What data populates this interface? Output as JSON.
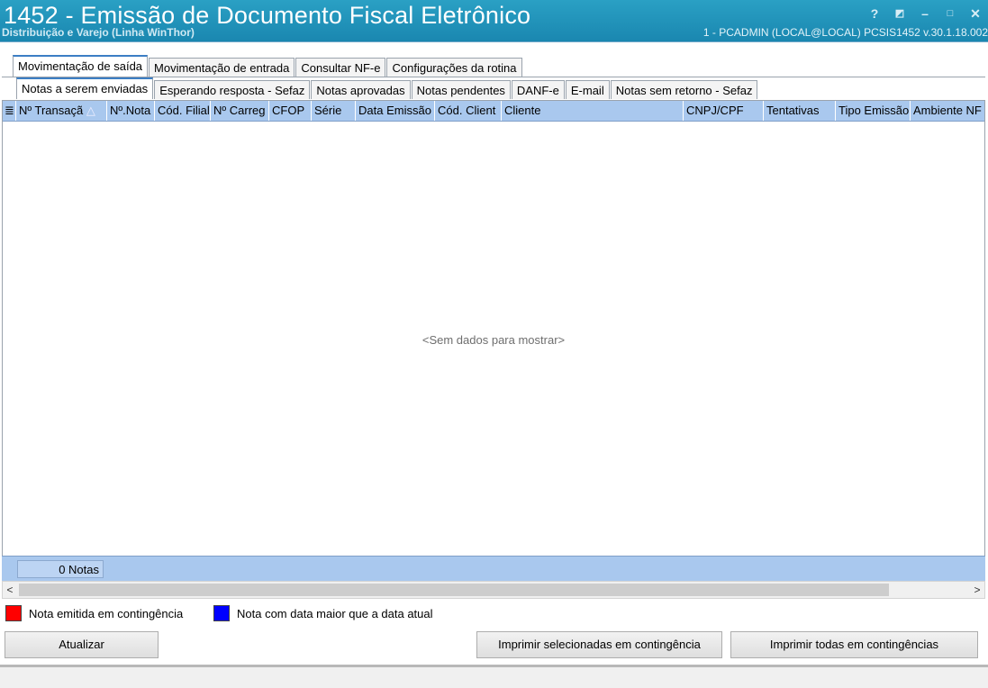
{
  "window": {
    "title": "1452 - Emissão de Documento Fiscal Eletrônico",
    "subtitle": "Distribuição e Varejo (Linha WinThor)",
    "userinfo": "1 - PCADMIN (LOCAL@LOCAL)   PCSIS1452  v.30.1.18.002",
    "buttons": {
      "help": "?",
      "restore": "◩",
      "minimize": "–",
      "maximize": "□",
      "close": "✕"
    }
  },
  "tabs_top": [
    {
      "label": "Movimentação de saída",
      "active": true
    },
    {
      "label": "Movimentação de entrada",
      "active": false
    },
    {
      "label": "Consultar NF-e",
      "active": false
    },
    {
      "label": "Configurações da rotina",
      "active": false
    }
  ],
  "tabs_sub": [
    {
      "label": "Notas a serem enviadas",
      "active": true
    },
    {
      "label": "Esperando resposta - Sefaz",
      "active": false
    },
    {
      "label": "Notas aprovadas",
      "active": false
    },
    {
      "label": "Notas pendentes",
      "active": false
    },
    {
      "label": "DANF-e",
      "active": false
    },
    {
      "label": "E-mail",
      "active": false
    },
    {
      "label": "Notas sem retorno - Sefaz",
      "active": false
    }
  ],
  "grid": {
    "columns": [
      "Nº Transaçã",
      "Nº.Nota",
      "Cód. Filial",
      "Nº Carreg",
      "CFOP",
      "Série",
      "Data Emissão",
      "Cód. Client",
      "Cliente",
      "CNPJ/CPF",
      "Tentativas",
      "Tipo Emissão",
      "Ambiente NF"
    ],
    "empty_text": "<Sem dados para mostrar>",
    "count_text": "0 Notas"
  },
  "legend": [
    {
      "color": "#ff0000",
      "label": "Nota emitida em contingência"
    },
    {
      "color": "#0000ff",
      "label": "Nota com data maior que a data atual"
    }
  ],
  "actions": {
    "update": "Atualizar",
    "print_selected": "Imprimir selecionadas em contingência",
    "print_all": "Imprimir todas em contingências"
  }
}
